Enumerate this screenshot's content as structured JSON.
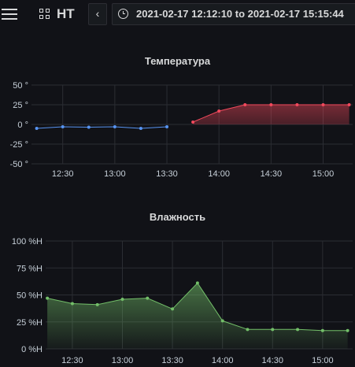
{
  "header": {
    "menu_icon": "hamburger-menu-icon",
    "dashboard_icon": "dashboard-grid-icon",
    "dashboard_title": "HT",
    "back_glyph": "‹",
    "back_icon": "chevron-left-icon",
    "time_icon": "clock-icon",
    "time_range": "2021-02-17 12:12:10 to 2021-02-17 15:15:44"
  },
  "panels": [
    {
      "title": "Температура",
      "y_tick_labels": [
        "50 °",
        "25 °",
        "0 °",
        "-25 °",
        "-50 °"
      ],
      "x_tick_labels": [
        "12:30",
        "13:00",
        "13:30",
        "14:00",
        "14:30",
        "15:00"
      ]
    },
    {
      "title": "Влажность",
      "y_tick_labels": [
        "100 %H",
        "75 %H",
        "50 %H",
        "25 %H",
        "0 %H"
      ],
      "x_tick_labels": [
        "12:30",
        "13:00",
        "13:30",
        "14:00",
        "14:30",
        "15:00"
      ]
    }
  ],
  "chart_data": [
    {
      "type": "line",
      "title": "Температура",
      "ylim": [
        -50,
        50
      ],
      "unit": "°",
      "grid": true,
      "x_ticks": [
        "12:30",
        "13:00",
        "13:30",
        "14:00",
        "14:30",
        "15:00"
      ],
      "series": [
        {
          "color": "#5794f2",
          "fill": false,
          "points": [
            [
              "12:15",
              -5
            ],
            [
              "12:30",
              -3
            ],
            [
              "12:45",
              -3.5
            ],
            [
              "13:00",
              -3
            ],
            [
              "13:15",
              -5
            ],
            [
              "13:30",
              -3
            ]
          ]
        },
        {
          "color": "#f2495c",
          "fill": true,
          "points": [
            [
              "13:45",
              3
            ],
            [
              "14:00",
              17
            ],
            [
              "14:15",
              25
            ],
            [
              "14:30",
              25
            ],
            [
              "14:45",
              25
            ],
            [
              "15:00",
              25
            ],
            [
              "15:15",
              25
            ]
          ]
        }
      ]
    },
    {
      "type": "area",
      "title": "Влажность",
      "ylim": [
        0,
        100
      ],
      "unit": "%H",
      "grid": true,
      "x_ticks": [
        "12:30",
        "13:00",
        "13:30",
        "14:00",
        "14:30",
        "15:00"
      ],
      "series": [
        {
          "color": "#73bf69",
          "fill": true,
          "points": [
            [
              "12:15",
              47
            ],
            [
              "12:30",
              42
            ],
            [
              "12:45",
              41
            ],
            [
              "13:00",
              46
            ],
            [
              "13:15",
              47
            ],
            [
              "13:30",
              37
            ],
            [
              "13:45",
              61
            ],
            [
              "14:00",
              26
            ],
            [
              "14:15",
              18
            ],
            [
              "14:30",
              18
            ],
            [
              "14:45",
              18
            ],
            [
              "15:00",
              17
            ],
            [
              "15:15",
              17
            ]
          ]
        }
      ]
    }
  ]
}
